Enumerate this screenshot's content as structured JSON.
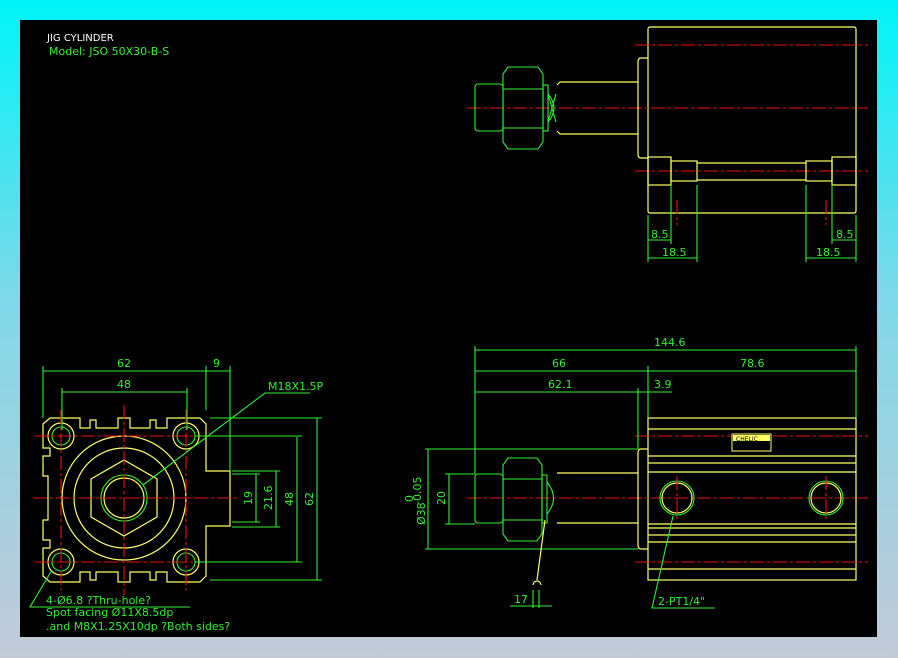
{
  "title": "JIG CYLINDER",
  "model": "Model:  JSO 50X30-B-S",
  "colors": {
    "background": "#000000",
    "outline": "#ffff66",
    "dimension": "#33ee33",
    "centerline": "#ee1111"
  },
  "top_view": {
    "dims": {
      "left_small": "8.5",
      "left_large": "18.5",
      "right_small": "8.5",
      "right_large": "18.5"
    }
  },
  "front_view": {
    "dims": {
      "width": "62",
      "port_offset": "9",
      "hole_pitch_h": "48",
      "port_19": "19",
      "port_21_6": "21.6",
      "hole_pitch_v": "48",
      "height": "62"
    },
    "thread_label": "M18X1.5P",
    "notes": [
      "4-Ø6.8   ?Thru-hole?",
      "Spot facing  Ø11X8.5dp",
      ".and M8X1.25X10dp ?Both sides?"
    ]
  },
  "side_view": {
    "dims": {
      "total": "144.6",
      "rod_part": "66",
      "body": "78.6",
      "to_flange": "62.1",
      "flange": "3.9",
      "bore": "Ø38",
      "bore_tol_upper": "0",
      "bore_tol_lower": "-0.05",
      "rod_end": "20",
      "wrench": "17"
    },
    "port_label": "2-PT1/4\"",
    "brand_label": "CHELIC"
  }
}
